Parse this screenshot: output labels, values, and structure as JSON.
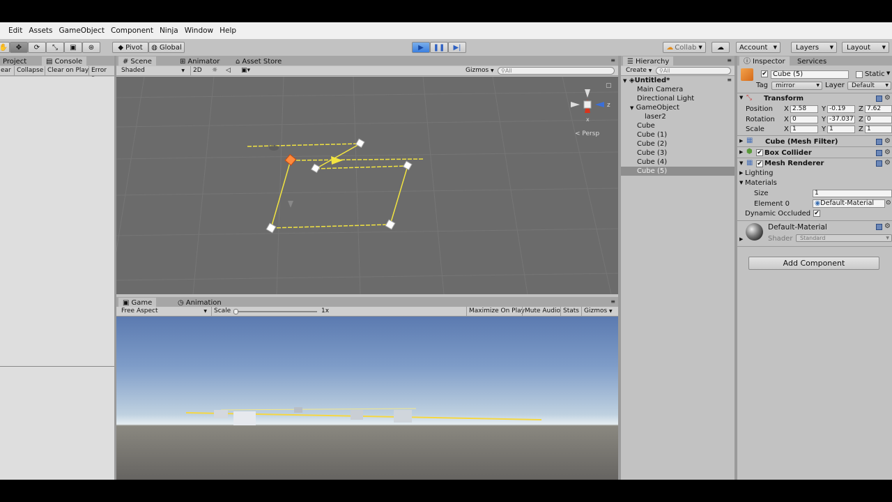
{
  "menu": [
    "Edit",
    "Assets",
    "GameObject",
    "Component",
    "Ninja",
    "Window",
    "Help"
  ],
  "toolbar": {
    "pivot": "Pivot",
    "global": "Global",
    "collab": "Collab",
    "account": "Account",
    "layers": "Layers",
    "layout": "Layout"
  },
  "left_panel": {
    "tab_project": "Project",
    "tab_console": "Console",
    "clear": "ear",
    "collapse": "Collapse",
    "clear_on_play": "Clear on Play",
    "error_pause": "Error Pa"
  },
  "scene": {
    "tab_scene": "Scene",
    "tab_animator": "Animator",
    "tab_asset_store": "Asset Store",
    "shading": "Shaded",
    "mode_2d": "2D",
    "gizmos": "Gizmos",
    "search_placeholder": "All",
    "persp": "Persp",
    "axis_z": "z",
    "axis_x": "x"
  },
  "game": {
    "tab_game": "Game",
    "tab_animation": "Animation",
    "aspect": "Free Aspect",
    "scale_label": "Scale",
    "scale_value": "1x",
    "maximize_on_play": "Maximize On Play",
    "mute_audio": "Mute Audio",
    "stats": "Stats",
    "gizmos": "Gizmos"
  },
  "hierarchy": {
    "tab": "Hierarchy",
    "create": "Create",
    "search_placeholder": "All",
    "scene_name": "Untitled*",
    "items": [
      "Main Camera",
      "Directional Light",
      "GameObject",
      "laser2",
      "Cube",
      "Cube (1)",
      "Cube (2)",
      "Cube (3)",
      "Cube (4)",
      "Cube (5)"
    ]
  },
  "inspector": {
    "tab": "Inspector",
    "services": "Services",
    "object_name": "Cube (5)",
    "static": "Static",
    "tag_label": "Tag",
    "tag_value": "mirror",
    "layer_label": "Layer",
    "layer_value": "Default",
    "transform": {
      "title": "Transform",
      "position_label": "Position",
      "rotation_label": "Rotation",
      "scale_label": "Scale",
      "x": "X",
      "y": "Y",
      "z": "Z",
      "position": [
        "2.58",
        "-0.19",
        "7.62"
      ],
      "rotation": [
        "0",
        "-37.037",
        "0"
      ],
      "scale": [
        "1",
        "1",
        "1"
      ]
    },
    "mesh_filter": "Cube (Mesh Filter)",
    "box_collider": "Box Collider",
    "mesh_renderer": "Mesh Renderer",
    "lighting": "Lighting",
    "materials": "Materials",
    "size_label": "Size",
    "size_value": "1",
    "element0_label": "Element 0",
    "element0_value": "Default-Material",
    "dynamic_occluded": "Dynamic Occluded",
    "material_name": "Default-Material",
    "shader_label": "Shader",
    "shader_value": "Standard",
    "add_component": "Add Component"
  },
  "colors": {
    "editor_bg": "#c2c2c2",
    "scene_bg": "#6b6b6b",
    "selection_yellow": "#f2e441",
    "play_blue": "#3b7fe0"
  }
}
